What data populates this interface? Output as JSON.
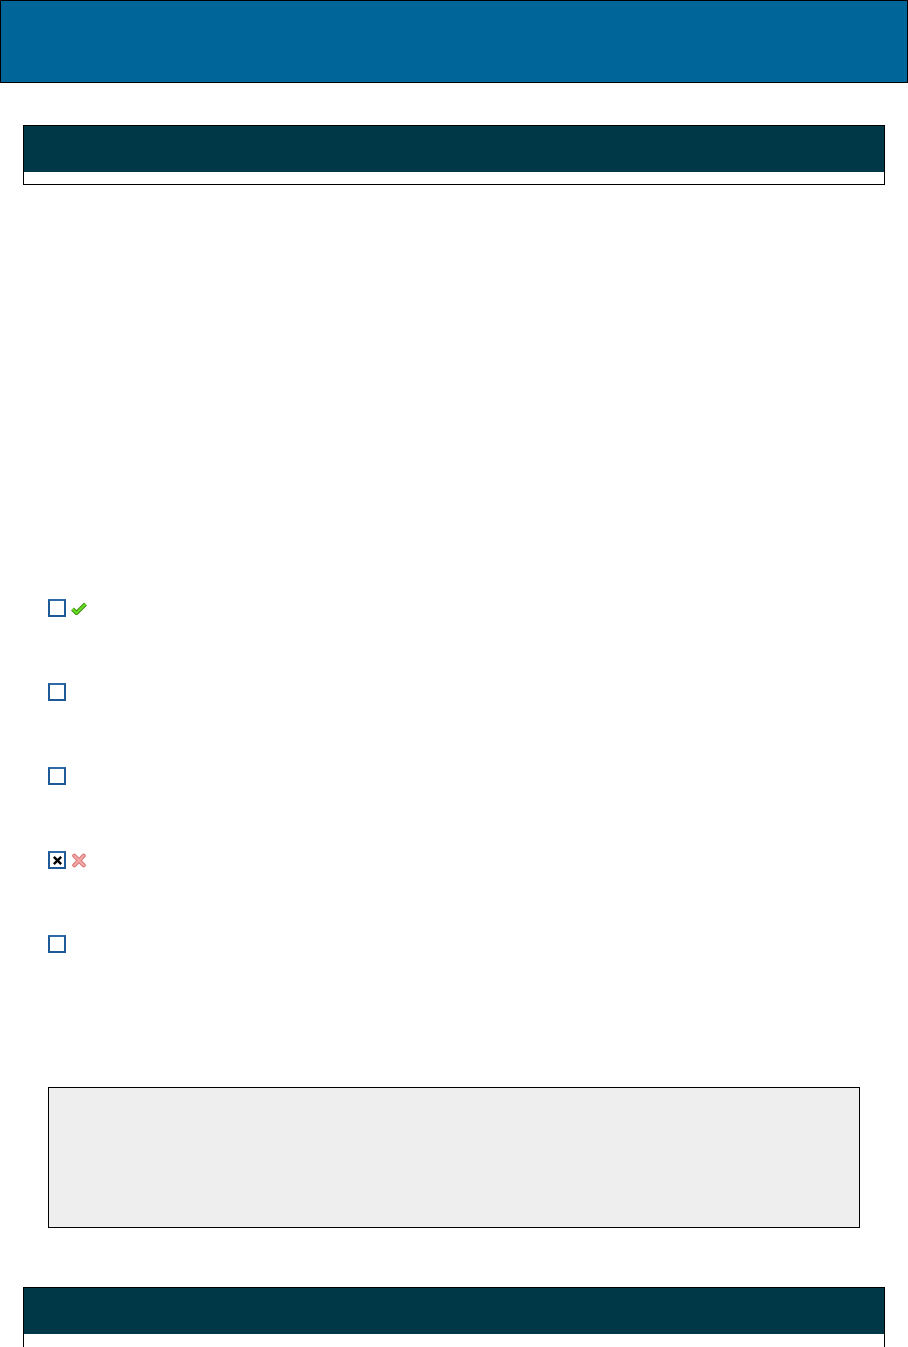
{
  "options": [
    {
      "checked": false,
      "marked_correct": true,
      "marked_wrong": false
    },
    {
      "checked": false,
      "marked_correct": false,
      "marked_wrong": false
    },
    {
      "checked": false,
      "marked_correct": false,
      "marked_wrong": false
    },
    {
      "checked": true,
      "marked_correct": false,
      "marked_wrong": true
    },
    {
      "checked": false,
      "marked_correct": false,
      "marked_wrong": false
    }
  ]
}
